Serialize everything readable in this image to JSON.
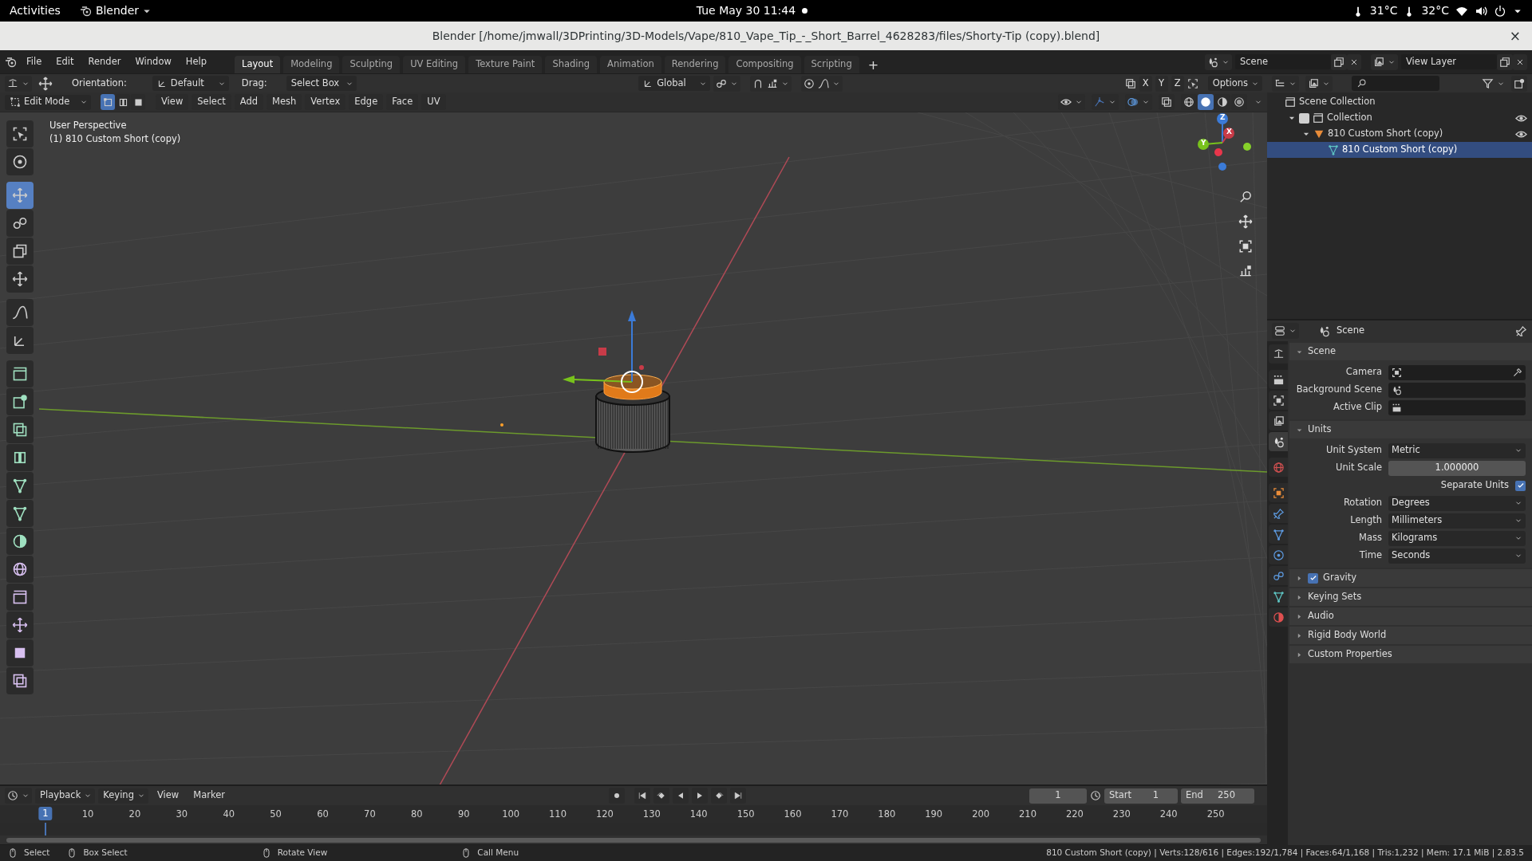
{
  "system_bar": {
    "activities": "Activities",
    "app_menu": "Blender",
    "clock": "Tue May 30  11:44",
    "temperatures": [
      "31°C",
      "32°C"
    ]
  },
  "window": {
    "title": "Blender [/home/jmwall/3DPrinting/3D-Models/Vape/810_Vape_Tip_-_Short_Barrel_4628283/files/Shorty-Tip (copy).blend]",
    "close": "×"
  },
  "menu": [
    "File",
    "Edit",
    "Render",
    "Window",
    "Help"
  ],
  "workspaces": [
    {
      "label": "Layout",
      "selected": true
    },
    {
      "label": "Modeling",
      "selected": false
    },
    {
      "label": "Sculpting",
      "selected": false
    },
    {
      "label": "UV Editing",
      "selected": false
    },
    {
      "label": "Texture Paint",
      "selected": false
    },
    {
      "label": "Shading",
      "selected": false
    },
    {
      "label": "Animation",
      "selected": false
    },
    {
      "label": "Rendering",
      "selected": false
    },
    {
      "label": "Compositing",
      "selected": false
    },
    {
      "label": "Scripting",
      "selected": false
    }
  ],
  "add_workspace": "+",
  "scene_field": "Scene",
  "view_layer_field": "View Layer",
  "tool_settings": {
    "orientation_label": "Orientation:",
    "orientation": "Default",
    "drag_label": "Drag:",
    "drag": "Select Box",
    "transform_orientation": "Global",
    "axes": [
      "X",
      "Y",
      "Z"
    ],
    "options": "Options"
  },
  "viewport_header": {
    "mode": "Edit Mode",
    "select_modes": [
      {
        "selected": true
      },
      {
        "selected": false
      },
      {
        "selected": false
      }
    ],
    "menus": [
      "View",
      "Select",
      "Add",
      "Mesh",
      "Vertex",
      "Edge",
      "Face",
      "UV"
    ],
    "shading": [
      {
        "selected": false
      },
      {
        "selected": true
      },
      {
        "selected": false
      },
      {
        "selected": false
      }
    ]
  },
  "viewport": {
    "overlay_lines": [
      "User Perspective",
      "(1) 810 Custom Short (copy)"
    ],
    "gizmo_labels": [
      "Z",
      "X",
      "Y"
    ]
  },
  "toolbar": [
    {
      "selected": false
    },
    {
      "selected": false
    },
    {
      "selected": true
    },
    {
      "selected": false
    },
    {
      "selected": false
    },
    {
      "selected": false
    },
    {
      "selected": false
    },
    {
      "selected": false
    },
    {
      "selected": false
    },
    {
      "selected": false
    },
    {
      "selected": false
    },
    {
      "selected": false
    },
    {
      "selected": false
    },
    {
      "selected": false
    },
    {
      "selected": false
    },
    {
      "selected": false
    },
    {
      "selected": false
    },
    {
      "selected": false
    },
    {
      "selected": false
    },
    {
      "selected": false
    }
  ],
  "outliner": {
    "items": [
      {
        "label": "Scene Collection",
        "kind": "scene_collection",
        "selected": false,
        "children": [
          {
            "label": "Collection",
            "kind": "collection",
            "selected": false,
            "expanded": true,
            "included": true,
            "visible": true,
            "children": [
              {
                "label": "810 Custom Short (copy)",
                "kind": "object",
                "selected": false,
                "expanded": true,
                "visible": true,
                "children": [
                  {
                    "label": "810 Custom Short (copy)",
                    "kind": "mesh",
                    "selected": true
                  }
                ]
              }
            ]
          }
        ]
      }
    ]
  },
  "properties": {
    "title": "Scene",
    "tabs": [
      {
        "selected": false
      },
      {
        "selected": false
      },
      {
        "selected": false
      },
      {
        "selected": false
      },
      {
        "selected": true
      },
      {
        "selected": false
      },
      {
        "selected": false
      },
      {
        "selected": false
      },
      {
        "selected": false
      },
      {
        "selected": false
      },
      {
        "selected": false
      },
      {
        "selected": false
      },
      {
        "selected": false
      }
    ],
    "sections": [
      {
        "title": "Scene",
        "expanded": true,
        "rows": [
          {
            "kind": "field",
            "label": "Camera"
          },
          {
            "kind": "field",
            "label": "Background Scene"
          },
          {
            "kind": "field",
            "label": "Active Clip"
          }
        ]
      },
      {
        "title": "Units",
        "expanded": true,
        "rows": [
          {
            "kind": "dropdown",
            "label": "Unit System",
            "value": "Metric"
          },
          {
            "kind": "number",
            "label": "Unit Scale",
            "value": "1.000000"
          },
          {
            "kind": "checkbox",
            "label": "Separate Units",
            "checked": true
          },
          {
            "kind": "dropdown",
            "label": "Rotation",
            "value": "Degrees"
          },
          {
            "kind": "dropdown",
            "label": "Length",
            "value": "Millimeters"
          },
          {
            "kind": "dropdown",
            "label": "Mass",
            "value": "Kilograms"
          },
          {
            "kind": "dropdown",
            "label": "Time",
            "value": "Seconds"
          }
        ]
      },
      {
        "title": "Gravity",
        "expanded": false,
        "checked": true
      },
      {
        "title": "Keying Sets",
        "expanded": false
      },
      {
        "title": "Audio",
        "expanded": false
      },
      {
        "title": "Rigid Body World",
        "expanded": false
      },
      {
        "title": "Custom Properties",
        "expanded": false
      }
    ]
  },
  "timeline": {
    "menus": [
      "Playback",
      "Keying",
      "View",
      "Marker"
    ],
    "current_frame": "1",
    "start_label": "Start",
    "start": "1",
    "end_label": "End",
    "end": "250",
    "playhead": "1",
    "ruler": [
      "10",
      "20",
      "30",
      "40",
      "50",
      "60",
      "70",
      "80",
      "90",
      "100",
      "110",
      "120",
      "130",
      "140",
      "150",
      "160",
      "170",
      "180",
      "190",
      "200",
      "210",
      "220",
      "230",
      "240",
      "250"
    ]
  },
  "status_bar": {
    "hints": [
      "Select",
      "Box Select",
      "Rotate View",
      "Call Menu"
    ],
    "stats": "810 Custom Short (copy) | Verts:128/616 | Edges:192/1,784 | Faces:64/1,168 | Tris:1,232 | Mem: 17.1 MiB | 2.83.5"
  }
}
